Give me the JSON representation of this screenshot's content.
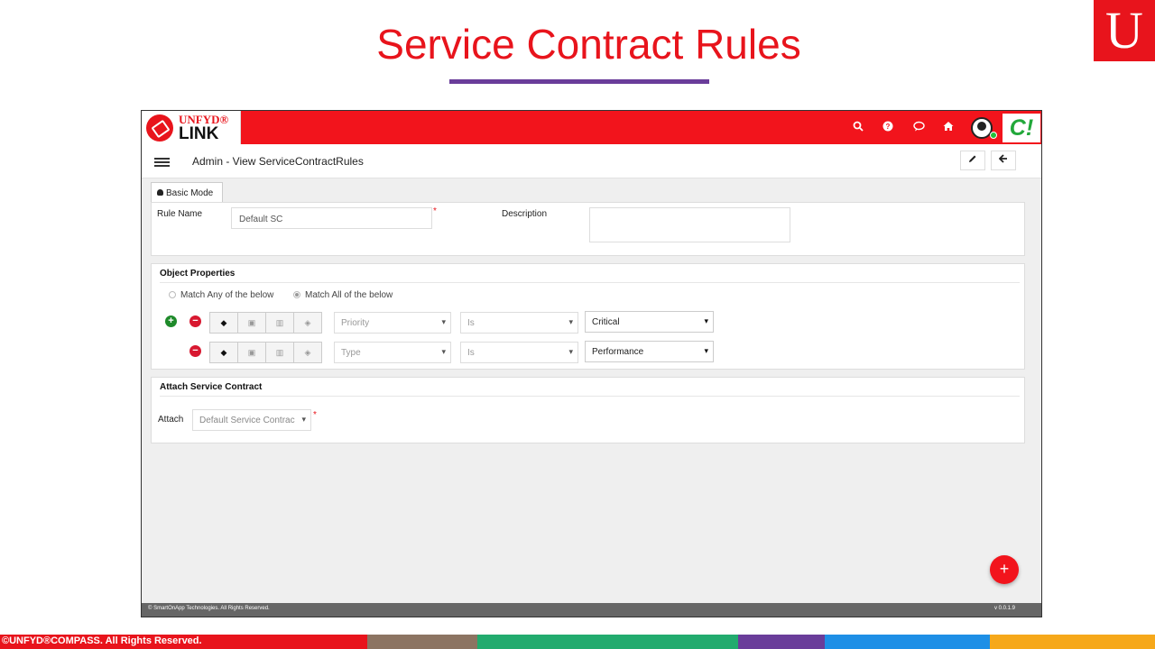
{
  "slide": {
    "title": "Service Contract Rules",
    "logo_letter": "U",
    "footer_text": "©UNFYD®COMPASS. All Rights Reserved.",
    "colors": {
      "accent": "#e8141c",
      "underline": "#6a3d9a"
    },
    "footer_bands": [
      {
        "color": "#e8141c",
        "width": 407
      },
      {
        "color": "#8c7462",
        "width": 122
      },
      {
        "color": "#22ab6e",
        "width": 289
      },
      {
        "color": "#6a3d9a",
        "width": 96
      },
      {
        "color": "#1e8fe6",
        "width": 183
      },
      {
        "color": "#f6a81a",
        "width": 183
      }
    ]
  },
  "app": {
    "brand": {
      "top": "UNFYD®",
      "bottom": "LINK"
    },
    "topbar_icons": [
      "search-icon",
      "help-icon",
      "chat-icon",
      "home-icon"
    ],
    "c_logo": "C!",
    "page_heading": "Admin - View ServiceContractRules",
    "tab_label": "Basic Mode",
    "rule_name": {
      "label": "Rule Name",
      "value": "Default SC"
    },
    "description": {
      "label": "Description",
      "value": ""
    },
    "object_properties": {
      "title": "Object Properties",
      "match_any": "Match Any of the below",
      "match_all": "Match All of the below",
      "selected": "match_all",
      "rows": [
        {
          "field": "Priority",
          "operator": "Is",
          "value": "Critical"
        },
        {
          "field": "Type",
          "operator": "Is",
          "value": "Performance"
        }
      ]
    },
    "attach_section": {
      "title": "Attach Service Contract",
      "label": "Attach",
      "value": "Default Service Contrac"
    },
    "footer_left": "© SmartOnApp Technologies. All Rights Reserved.",
    "footer_right": "v 0.0.1.9",
    "fab_label": "+"
  }
}
